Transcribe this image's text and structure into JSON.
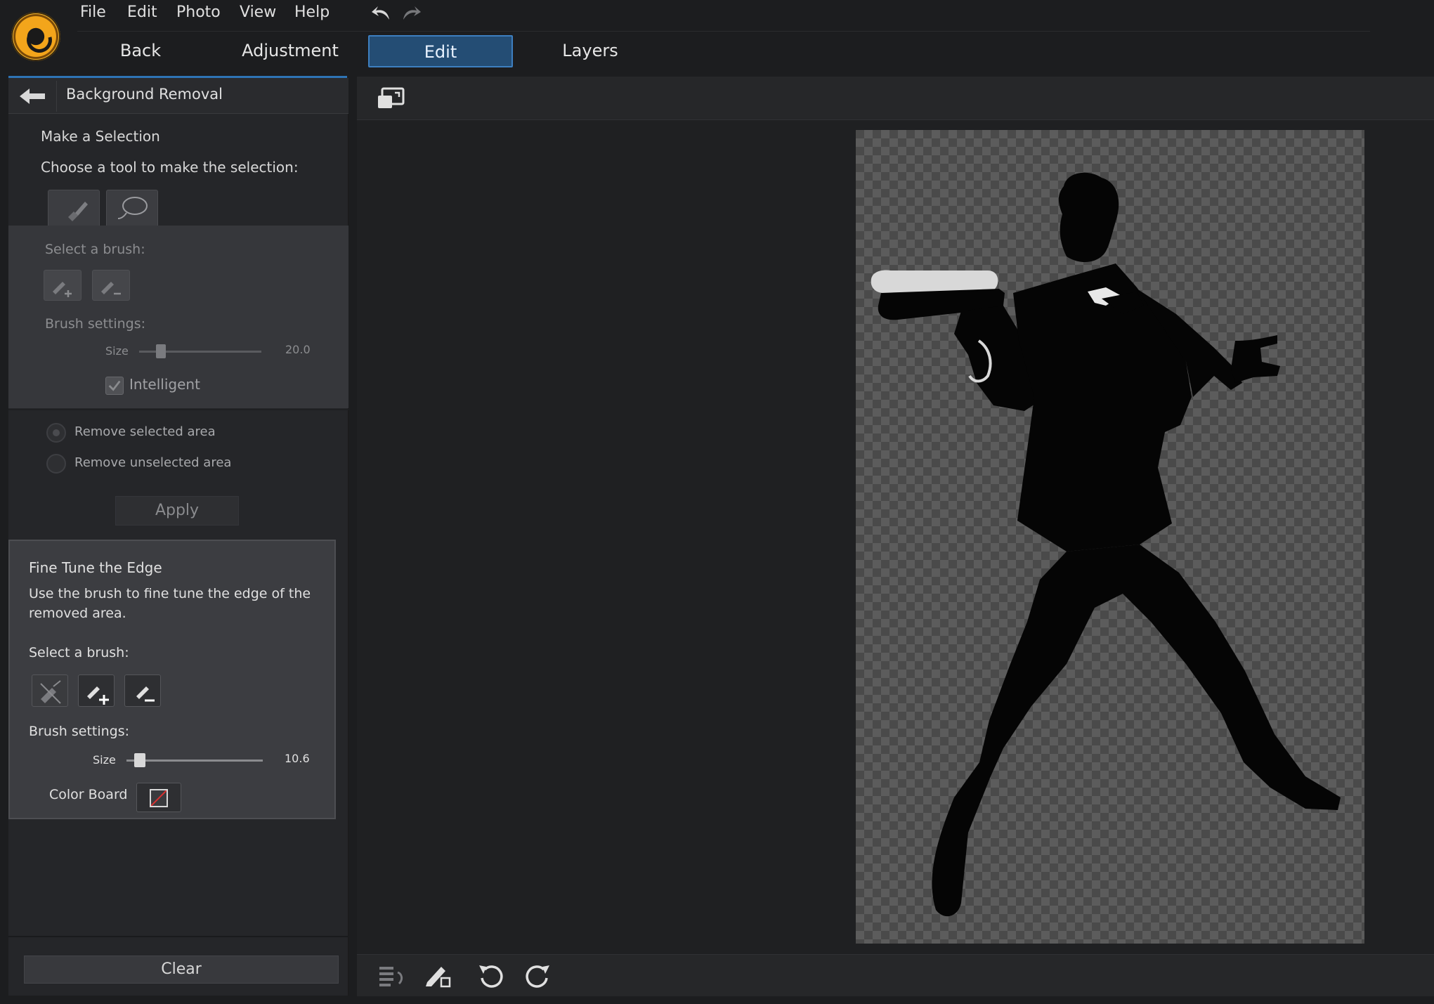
{
  "menu": {
    "file": "File",
    "edit": "Edit",
    "photo": "Photo",
    "view": "View",
    "help": "Help"
  },
  "tabs": {
    "back": "Back",
    "adjustment": "Adjustment",
    "edit": "Edit",
    "layers": "Layers"
  },
  "panel": {
    "title": "Background Removal",
    "make_selection": "Make a Selection",
    "choose_tool": "Choose a tool to make the selection:",
    "select_brush": "Select a brush:",
    "brush_settings": "Brush settings:",
    "size_label": "Size",
    "size_value": "20.0",
    "size_level": 0.18,
    "intelligent": "Intelligent",
    "remove_selected": "Remove selected area",
    "remove_unselected": "Remove unselected area",
    "apply": "Apply"
  },
  "fine_tune": {
    "title": "Fine Tune the Edge",
    "desc_line1": "Use the brush to fine tune the edge of the",
    "desc_line2": "removed area.",
    "select_brush": "Select a brush:",
    "brush_settings": "Brush settings:",
    "size_label": "Size",
    "size_value": "10.6",
    "size_level": 0.1,
    "color_board": "Color Board"
  },
  "footer": {
    "clear": "Clear"
  },
  "colors": {
    "accent": "#2e74b5",
    "tab_active": "#244d74",
    "logo": "#f3a51b"
  },
  "icons": [
    "undo-icon",
    "redo-icon",
    "back-arrow-icon",
    "brush-tool-icon",
    "lasso-icon",
    "brush-add-icon",
    "brush-remove-icon",
    "fit-view-icon",
    "history-icon",
    "eraser-icon",
    "rotate-left-icon",
    "rotate-right-icon"
  ]
}
